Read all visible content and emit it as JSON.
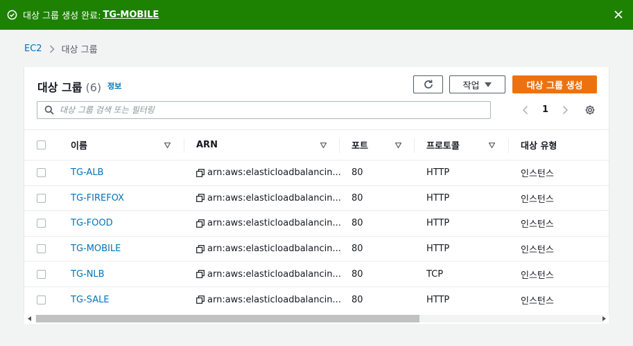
{
  "flash": {
    "message": "대상 그룹 생성 완료:",
    "link_text": "TG-MOBILE",
    "icon": "check-circle-icon",
    "close_icon": "close-icon",
    "color": "#1d8102"
  },
  "breadcrumb": {
    "root": "EC2",
    "current": "대상 그룹"
  },
  "panel": {
    "title": "대상 그룹",
    "count": "(6)",
    "info_link": "정보",
    "actions_label": "작업",
    "create_label": "대상 그룹 생성",
    "refresh_icon": "refresh-icon",
    "search_placeholder": "대상 그룹 검색 또는 필터링",
    "page": "1",
    "accent_color": "#ec7211"
  },
  "table": {
    "columns": [
      "이름",
      "ARN",
      "포트",
      "프로토콜",
      "대상 유형"
    ],
    "rows": [
      {
        "name": "TG-ALB",
        "arn": "arn:aws:elasticloadbalancin...",
        "port": "80",
        "protocol": "HTTP",
        "type": "인스턴스"
      },
      {
        "name": "TG-FIREFOX",
        "arn": "arn:aws:elasticloadbalancin...",
        "port": "80",
        "protocol": "HTTP",
        "type": "인스턴스"
      },
      {
        "name": "TG-FOOD",
        "arn": "arn:aws:elasticloadbalancin...",
        "port": "80",
        "protocol": "HTTP",
        "type": "인스턴스"
      },
      {
        "name": "TG-MOBILE",
        "arn": "arn:aws:elasticloadbalancin...",
        "port": "80",
        "protocol": "HTTP",
        "type": "인스턴스"
      },
      {
        "name": "TG-NLB",
        "arn": "arn:aws:elasticloadbalancin...",
        "port": "80",
        "protocol": "TCP",
        "type": "인스턴스"
      },
      {
        "name": "TG-SALE",
        "arn": "arn:aws:elasticloadbalancin...",
        "port": "80",
        "protocol": "HTTP",
        "type": "인스턴스"
      }
    ]
  }
}
